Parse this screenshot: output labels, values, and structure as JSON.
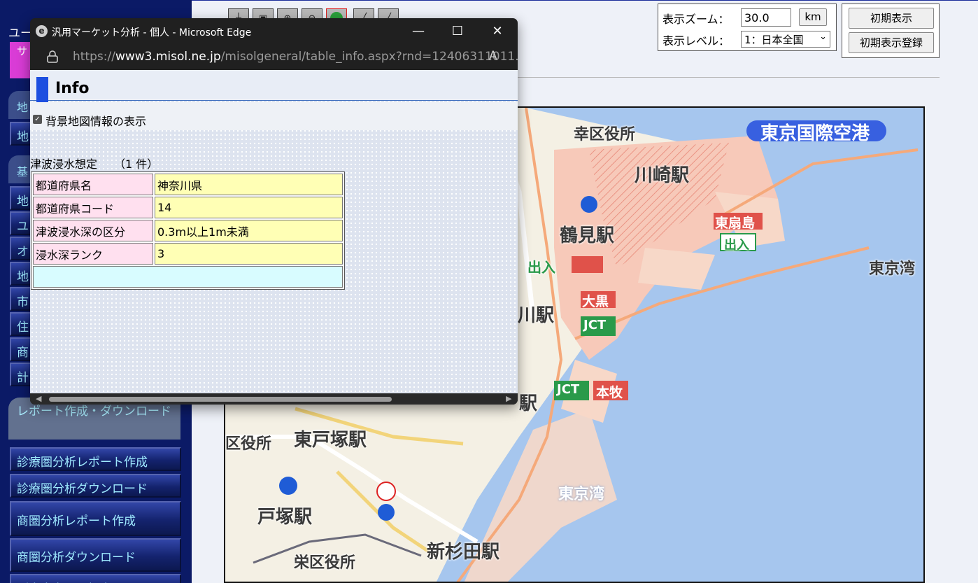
{
  "sidebar": {
    "user_label": "ユー",
    "service_label": "サ FA",
    "sections": [
      "地",
      "基"
    ],
    "top_buttons": [
      "地"
    ],
    "menu_buttons": [
      "地",
      "ユ",
      "オ",
      "地",
      "市",
      "住",
      "商",
      "計"
    ],
    "report_section": "レポート作成・ダウンロード",
    "report_buttons": [
      "診療圏分析レポート作成",
      "診療圏分析ダウンロード",
      "商圏分析レポート作成",
      "商圏分析ダウンロード",
      "販売出力項目設定"
    ]
  },
  "toolbar": {
    "icons": [
      "pin-tool-icon",
      "map-tool-icon",
      "zoom-in-icon",
      "zoom-out-icon",
      "info-tool-icon",
      "measure-tool-icon",
      "ruler-tool-icon"
    ]
  },
  "zoom": {
    "zoom_label": "表示ズーム：",
    "zoom_value": "30.0",
    "km_button": "km",
    "level_label": "表示レベル：",
    "level_value": "1：日本全国"
  },
  "init": {
    "show_button": "初期表示",
    "register_button": "初期表示登録"
  },
  "map": {
    "labels": [
      "東京国際空港",
      "幸区役所",
      "川崎駅",
      "鶴見駅",
      "東扇島",
      "出入",
      "東京湾",
      "出入",
      "大黒",
      "川駅",
      "JCT",
      "JCT",
      "本牧",
      "東戸塚駅",
      "区役所",
      "戸塚駅",
      "東京湾",
      "栄区役所",
      "新杉田駅",
      "駅"
    ],
    "colors": {
      "water": "#a6c6ee",
      "land": "#f4f0e4",
      "flood": "#f7c9b9",
      "road": "#f5a97a"
    }
  },
  "popup": {
    "window_title": "汎用マーケット分析 - 個人 - Microsoft Edge",
    "url_prefix": "https://",
    "url_host": "www3.misol.ne.jp",
    "url_rest": "/misolgeneral/table_info.aspx?rnd=12406311011...",
    "read_aloud": "A",
    "info_heading": "Info",
    "bg_checkbox_label": "背景地図情報の表示",
    "bg_checkbox_checked": true,
    "tsunami_title": "津波浸水想定　　（1 件）",
    "rows": [
      {
        "key": "都道府県名",
        "value": "神奈川県"
      },
      {
        "key": "都道府県コード",
        "value": "14"
      },
      {
        "key": "津波浸水深の区分",
        "value": "0.3m以上1m未満"
      },
      {
        "key": "浸水深ランク",
        "value": "3"
      }
    ]
  }
}
